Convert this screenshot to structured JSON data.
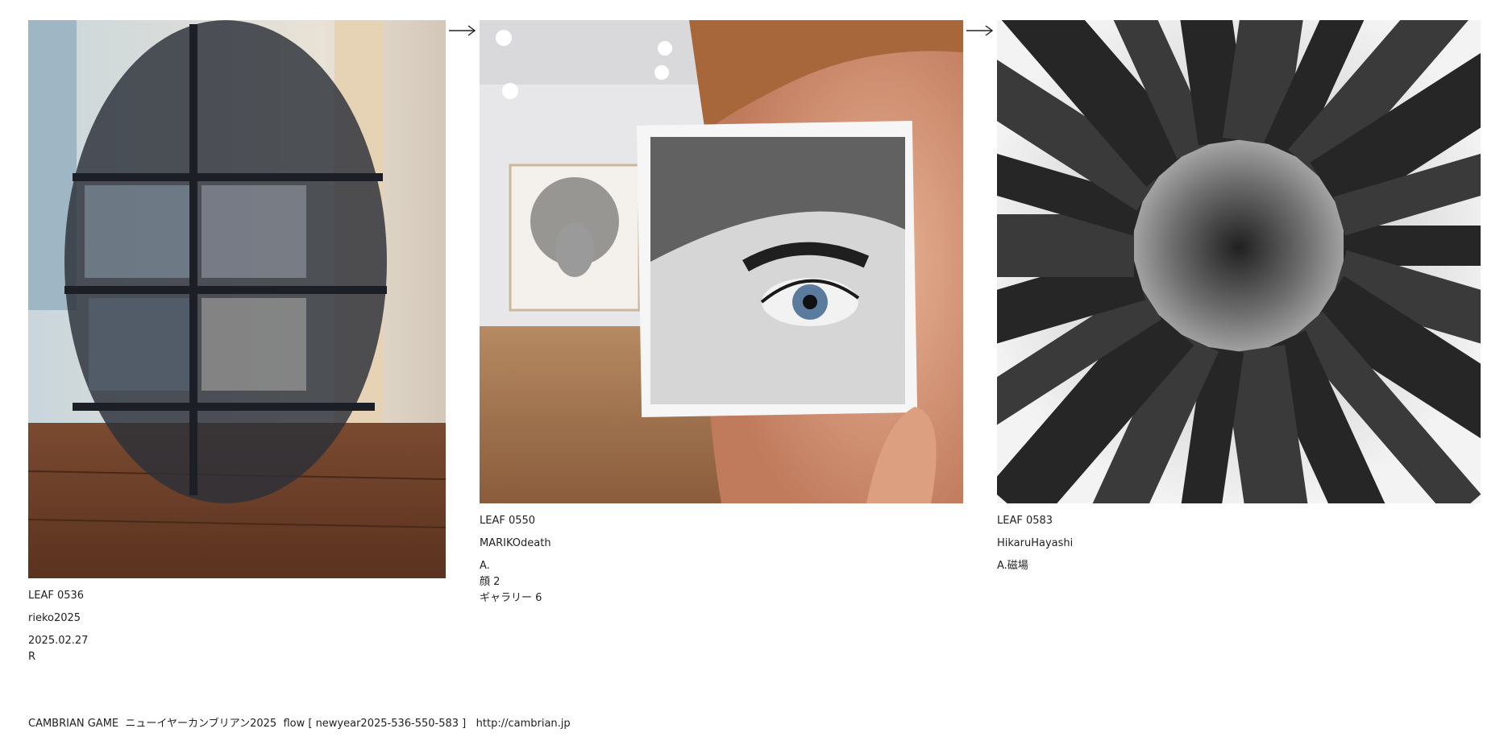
{
  "leaves": [
    {
      "image_icon": "screen-mesh-photo",
      "id_label": "LEAF 0536",
      "author": "rieko2025",
      "date": "2025.02.27",
      "note": "R"
    },
    {
      "image_icon": "eye-sketch-photo",
      "id_label": "LEAF 0550",
      "author": "MARIKOdeath",
      "lines": [
        "A.",
        "顔 2",
        "ギャラリー 6"
      ]
    },
    {
      "image_icon": "city-fisheye-photo",
      "id_label": "LEAF 0583",
      "author": "HikaruHayashi",
      "lines": [
        "A.磁場"
      ]
    }
  ],
  "arrow_icon": "right-arrow-icon",
  "footer": {
    "game": "CAMBRIAN GAME",
    "event": "ニューイヤーカンブリアン2025",
    "flow": "flow [ newyear2025-536-550-583 ]",
    "url": "http://cambrian.jp"
  }
}
